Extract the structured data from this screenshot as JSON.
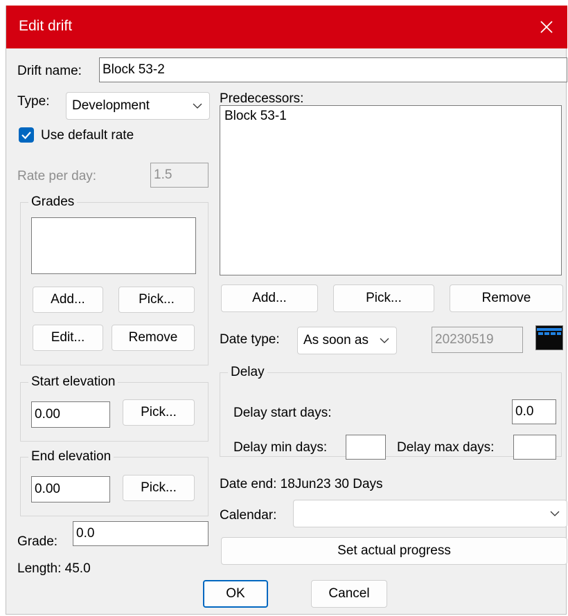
{
  "window": {
    "title": "Edit drift"
  },
  "drift_name": {
    "label": "Drift name:",
    "value": "Block 53-2"
  },
  "type": {
    "label": "Type:",
    "value": "Development"
  },
  "use_default_rate": {
    "label": "Use default rate",
    "checked": true
  },
  "rate_per_day": {
    "label": "Rate per day:",
    "value": "1.5"
  },
  "grades": {
    "title": "Grades",
    "add": "Add...",
    "pick": "Pick...",
    "edit": "Edit...",
    "remove": "Remove"
  },
  "start_elevation": {
    "title": "Start elevation",
    "value": "0.00",
    "pick": "Pick..."
  },
  "end_elevation": {
    "title": "End elevation",
    "value": "0.00",
    "pick": "Pick..."
  },
  "grade": {
    "label": "Grade:",
    "value": "0.0"
  },
  "length": {
    "text": "Length: 45.0"
  },
  "predecessors": {
    "label": "Predecessors:",
    "items": [
      "Block 53-1"
    ],
    "add": "Add...",
    "pick": "Pick...",
    "remove": "Remove"
  },
  "date_type": {
    "label": "Date type:",
    "value": "As soon as",
    "date": "20230519"
  },
  "delay": {
    "title": "Delay",
    "start_label": "Delay start days:",
    "start_value": "0.0",
    "min_label": "Delay min days:",
    "min_value": "",
    "max_label": "Delay max days:",
    "max_value": ""
  },
  "date_end": {
    "text": "Date end: 18Jun23  30 Days"
  },
  "calendar": {
    "label": "Calendar:",
    "value": ""
  },
  "set_actual_progress": "Set actual progress",
  "ok": "OK",
  "cancel": "Cancel",
  "colors": {
    "titlebar": "#d40010",
    "accent": "#0067c0"
  }
}
